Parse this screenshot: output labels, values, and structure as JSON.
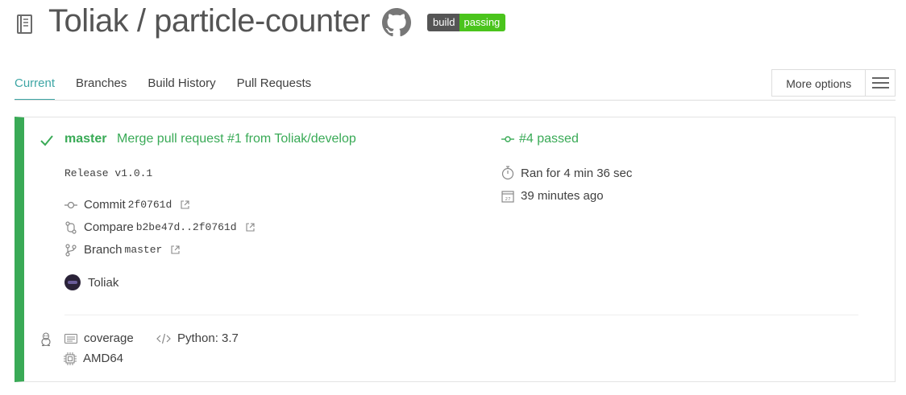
{
  "header": {
    "owner": "Toliak",
    "separator": " / ",
    "repo": "particle-counter",
    "badge": {
      "left": "build",
      "right": "passing"
    }
  },
  "tabs": [
    {
      "label": "Current",
      "active": true
    },
    {
      "label": "Branches",
      "active": false
    },
    {
      "label": "Build History",
      "active": false
    },
    {
      "label": "Pull Requests",
      "active": false
    }
  ],
  "more_options": {
    "label": "More options"
  },
  "build": {
    "branch": "master",
    "message": "Merge pull request #1 from Toliak/develop",
    "description": "Release v1.0.1",
    "commit": {
      "label": "Commit",
      "value": "2f0761d"
    },
    "compare": {
      "label": "Compare",
      "value": "b2be47d..2f0761d"
    },
    "branch_link": {
      "label": "Branch",
      "value": "master"
    },
    "author": "Toliak",
    "number": "#4 passed",
    "duration": "Ran for 4 min 36 sec",
    "finished": "39 minutes ago"
  },
  "job": {
    "env": "coverage",
    "language": "Python: 3.7",
    "arch": "AMD64"
  },
  "colors": {
    "passed": "#39aa56",
    "active_tab": "#3ea6a5",
    "badge_left": "#555555",
    "badge_right": "#4ac41c"
  },
  "icons": [
    "repo-icon",
    "github-icon",
    "check-icon",
    "commit-icon",
    "compare-icon",
    "branch-icon",
    "external-link-icon",
    "stopwatch-icon",
    "calendar-icon",
    "linux-icon",
    "env-icon",
    "code-icon",
    "cpu-icon",
    "hamburger-icon"
  ]
}
